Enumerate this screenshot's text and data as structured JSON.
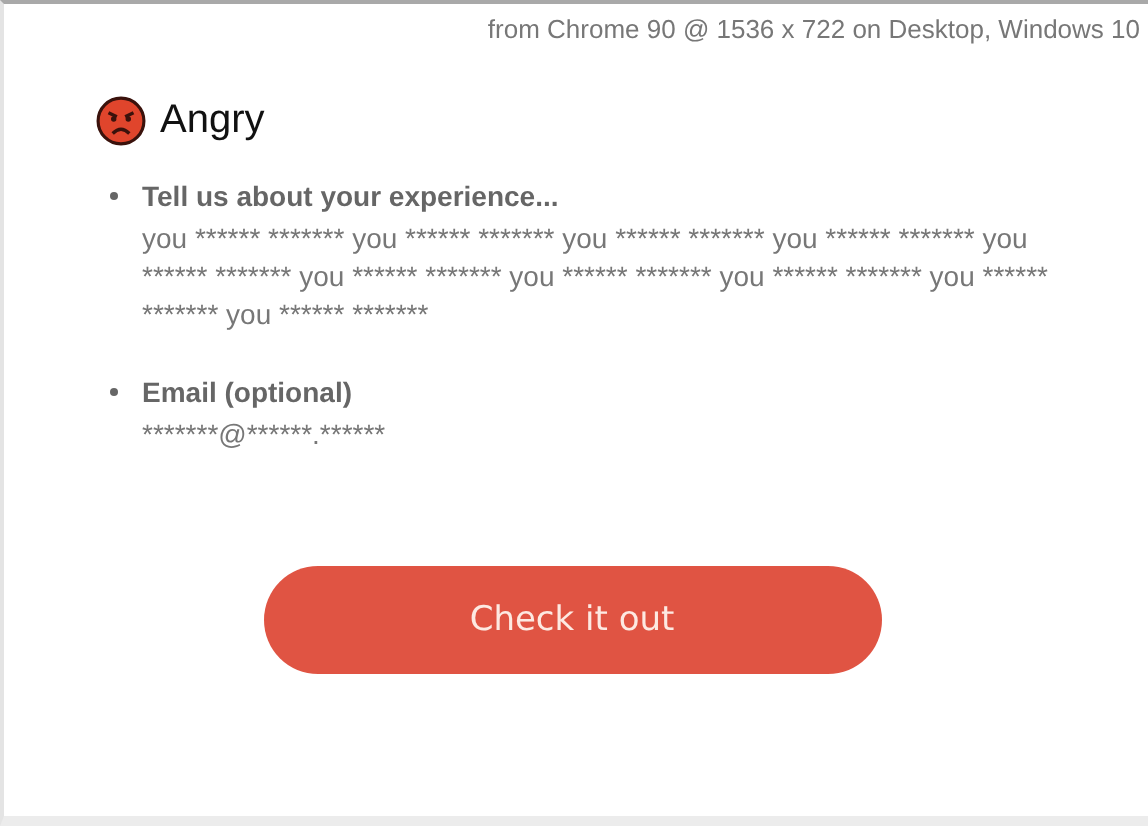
{
  "caption": "from Chrome 90 @ 1536 x 722 on Desktop, Windows 10",
  "mood": {
    "label": "Angry"
  },
  "fields": [
    {
      "label": "Tell us about your experience...",
      "value": "you ****** ******* you ****** ******* you ****** ******* you ****** ******* you ****** ******* you ****** ******* you ****** ******* you ****** ******* you ****** ******* you ****** *******"
    },
    {
      "label": "Email (optional)",
      "value": "*******@******.******"
    }
  ],
  "button": "Check it out"
}
